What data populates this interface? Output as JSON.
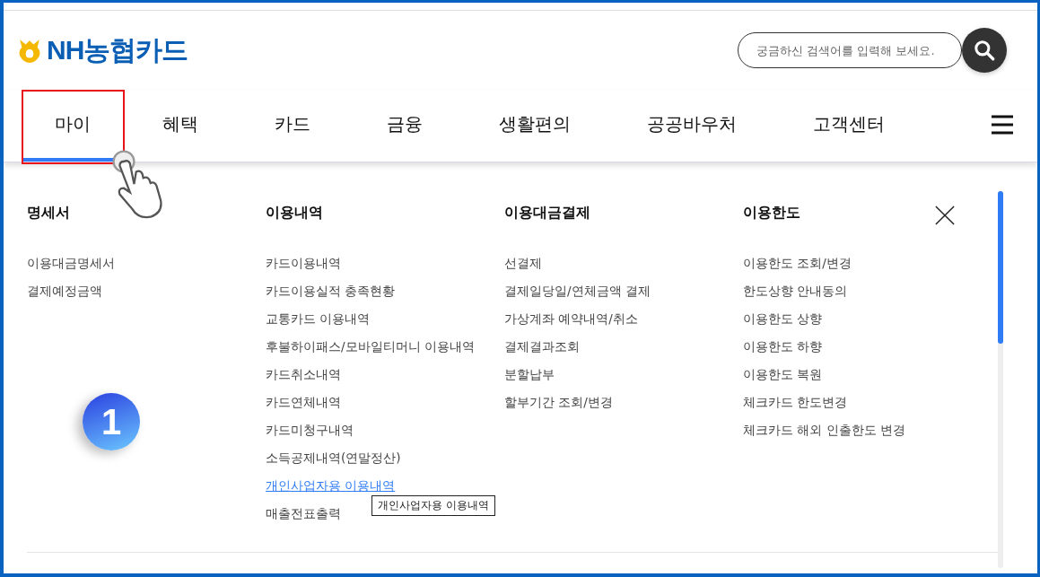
{
  "logo": {
    "text": "NH농협카드"
  },
  "search": {
    "placeholder": "궁금하신 검색어를 입력해 보세요."
  },
  "nav": {
    "tabs": [
      {
        "label": "마이",
        "selected": true
      },
      {
        "label": "혜택",
        "selected": false
      },
      {
        "label": "카드",
        "selected": false
      },
      {
        "label": "금융",
        "selected": false
      },
      {
        "label": "생활편의",
        "selected": false
      },
      {
        "label": "공공바우처",
        "selected": false
      },
      {
        "label": "고객센터",
        "selected": false
      }
    ]
  },
  "annotation": {
    "step": "1"
  },
  "menu": {
    "columns": [
      {
        "heading": "명세서",
        "items": [
          {
            "label": "이용대금명세서",
            "hovered": false
          },
          {
            "label": "결제예정금액",
            "hovered": false
          }
        ]
      },
      {
        "heading": "이용내역",
        "items": [
          {
            "label": "카드이용내역",
            "hovered": false
          },
          {
            "label": "카드이용실적 충족현황",
            "hovered": false
          },
          {
            "label": "교통카드 이용내역",
            "hovered": false
          },
          {
            "label": "후불하이패스/모바일티머니 이용내역",
            "hovered": false
          },
          {
            "label": "카드취소내역",
            "hovered": false
          },
          {
            "label": "카드연체내역",
            "hovered": false
          },
          {
            "label": "카드미청구내역",
            "hovered": false
          },
          {
            "label": "소득공제내역(연말정산)",
            "hovered": false
          },
          {
            "label": "개인사업자용 이용내역",
            "hovered": true
          },
          {
            "label": "매출전표출력",
            "hovered": false
          }
        ]
      },
      {
        "heading": "이용대금결제",
        "items": [
          {
            "label": "선결제",
            "hovered": false
          },
          {
            "label": "결제일당일/연체금액 결제",
            "hovered": false
          },
          {
            "label": "가상계좌 예약내역/취소",
            "hovered": false
          },
          {
            "label": "결제결과조회",
            "hovered": false
          },
          {
            "label": "분할납부",
            "hovered": false
          },
          {
            "label": "할부기간 조회/변경",
            "hovered": false
          }
        ]
      },
      {
        "heading": "이용한도",
        "items": [
          {
            "label": "이용한도 조회/변경",
            "hovered": false
          },
          {
            "label": "한도상향 안내동의",
            "hovered": false
          },
          {
            "label": "이용한도 상향",
            "hovered": false
          },
          {
            "label": "이용한도 하향",
            "hovered": false
          },
          {
            "label": "이용한도 복원",
            "hovered": false
          },
          {
            "label": "체크카드 한도변경",
            "hovered": false
          },
          {
            "label": "체크카드 해외 인출한도 변경",
            "hovered": false
          }
        ]
      }
    ]
  },
  "tooltip": {
    "text": "개인사업자용 이용내역"
  }
}
